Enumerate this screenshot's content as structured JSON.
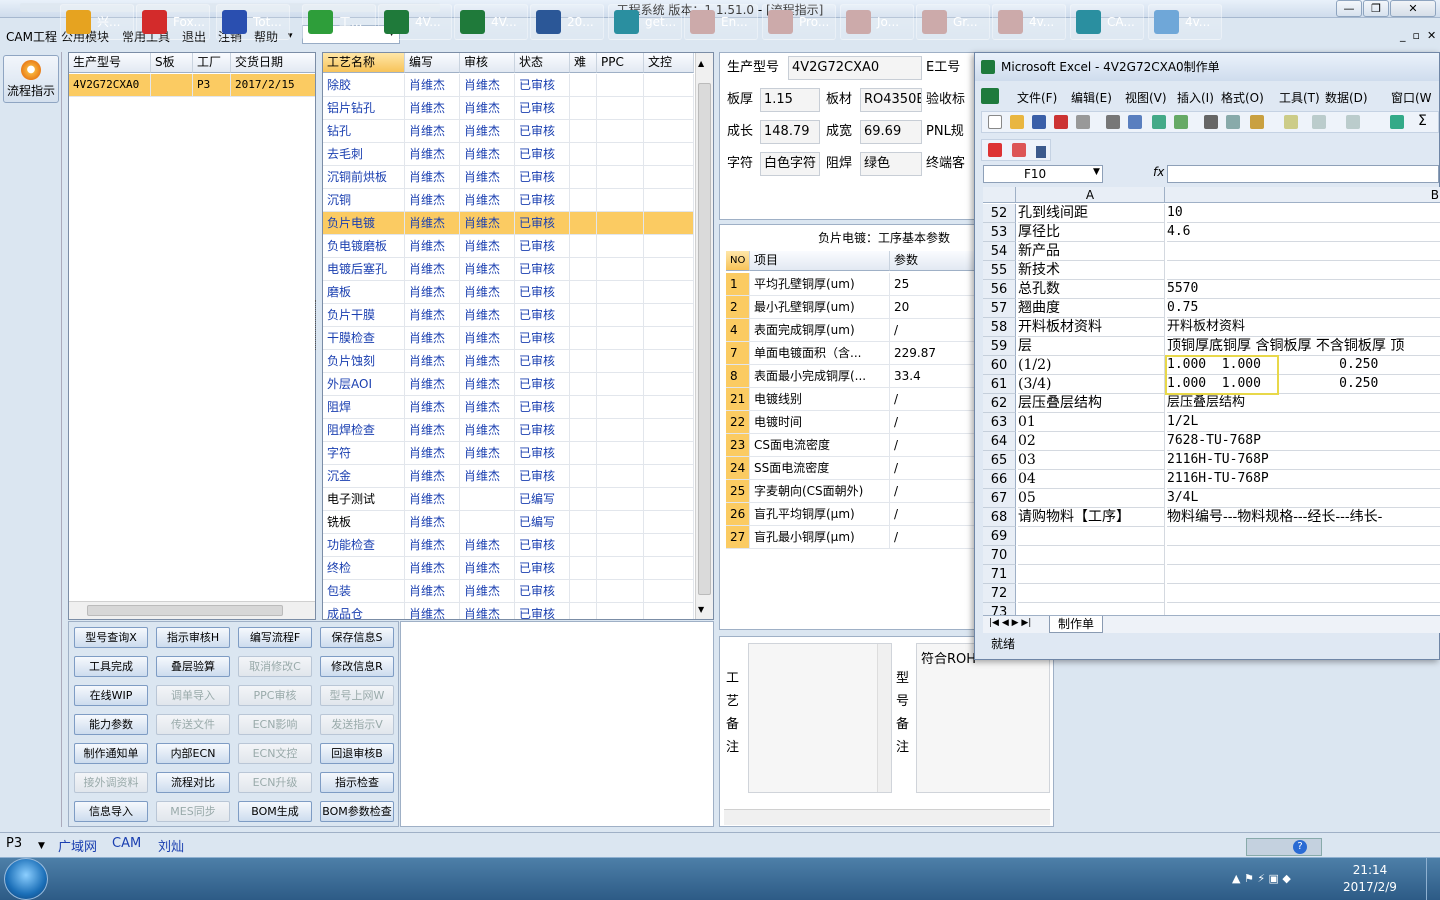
{
  "window": {
    "title": "工程系统 版本：1.1.51.0 - [流程指示]"
  },
  "menu": [
    "CAM工程",
    "公用模块",
    "常用工具",
    "退出",
    "注销",
    "帮助"
  ],
  "left": {
    "flow_button": "流程指示"
  },
  "order_grid": {
    "headers": [
      "生产型号",
      "S板",
      "工厂",
      "交货日期"
    ],
    "rows": [
      [
        "4V2G72CXA0",
        "",
        "P3",
        "2017/2/15"
      ]
    ]
  },
  "process_grid": {
    "headers": [
      "工艺名称",
      "编写",
      "审核",
      "状态",
      "难",
      "PPC",
      "文控"
    ],
    "rows": [
      [
        "除胶",
        "肖维杰",
        "肖维杰",
        "已审核"
      ],
      [
        "铝片钻孔",
        "肖维杰",
        "肖维杰",
        "已审核"
      ],
      [
        "钻孔",
        "肖维杰",
        "肖维杰",
        "已审核"
      ],
      [
        "去毛刺",
        "肖维杰",
        "肖维杰",
        "已审核"
      ],
      [
        "沉铜前烘板",
        "肖维杰",
        "肖维杰",
        "已审核"
      ],
      [
        "沉铜",
        "肖维杰",
        "肖维杰",
        "已审核"
      ],
      [
        "负片电镀",
        "肖维杰",
        "肖维杰",
        "已审核"
      ],
      [
        "负电镀磨板",
        "肖维杰",
        "肖维杰",
        "已审核"
      ],
      [
        "电镀后塞孔",
        "肖维杰",
        "肖维杰",
        "已审核"
      ],
      [
        "磨板",
        "肖维杰",
        "肖维杰",
        "已审核"
      ],
      [
        "负片干膜",
        "肖维杰",
        "肖维杰",
        "已审核"
      ],
      [
        "干膜检查",
        "肖维杰",
        "肖维杰",
        "已审核"
      ],
      [
        "负片蚀刻",
        "肖维杰",
        "肖维杰",
        "已审核"
      ],
      [
        "外层AOI",
        "肖维杰",
        "肖维杰",
        "已审核"
      ],
      [
        "阻焊",
        "肖维杰",
        "肖维杰",
        "已审核"
      ],
      [
        "阻焊检查",
        "肖维杰",
        "肖维杰",
        "已审核"
      ],
      [
        "字符",
        "肖维杰",
        "肖维杰",
        "已审核"
      ],
      [
        "沉金",
        "肖维杰",
        "肖维杰",
        "已审核"
      ],
      [
        "电子测试",
        "肖维杰",
        "",
        "已编写"
      ],
      [
        "铣板",
        "肖维杰",
        "",
        "已编写"
      ],
      [
        "功能检查",
        "肖维杰",
        "肖维杰",
        "已审核"
      ],
      [
        "终检",
        "肖维杰",
        "肖维杰",
        "已审核"
      ],
      [
        "包装",
        "肖维杰",
        "肖维杰",
        "已审核"
      ],
      [
        "成品仓",
        "肖维杰",
        "肖维杰",
        "已审核"
      ]
    ]
  },
  "buttons": [
    [
      "型号查询X",
      "指示审核H",
      "编写流程F",
      "保存信息S"
    ],
    [
      "工具完成",
      "叠层验算",
      "取消修改C",
      "修改信息R"
    ],
    [
      "在线WIP",
      "调单导入",
      "PPC审核",
      "型号上网W"
    ],
    [
      "能力参数",
      "传送文件",
      "ECN影响",
      "发送指示V"
    ],
    [
      "制作通知单",
      "内部ECN",
      "ECN文控",
      "回退审核B"
    ],
    [
      "接外调资料",
      "流程对比",
      "ECN升级",
      "指示检查"
    ],
    [
      "信息导入",
      "MES同步",
      "BOM生成",
      "BOM参数检查"
    ]
  ],
  "info": {
    "model_label": "生产型号",
    "model_value": "4V2G72CXA0",
    "e_label": "E工号",
    "thick_label": "板厚",
    "thick_value": "1.15",
    "mat_label": "板材",
    "mat_value": "RO4350B",
    "accept_label": "验收标",
    "len_label": "成长",
    "len_value": "148.79",
    "wid_label": "成宽",
    "wid_value": "69.69",
    "pnl_label": "PNL规",
    "char_label": "字符",
    "char_value": "白色字符",
    "mask_label": "阻焊",
    "mask_value": "绿色",
    "end_label": "终端客"
  },
  "params": {
    "title": "负片电镀：工序基本参数",
    "headers": [
      "NO",
      "项目",
      "参数"
    ],
    "rows": [
      [
        "1",
        "平均孔壁铜厚(um)",
        "25"
      ],
      [
        "2",
        "最小孔壁铜厚(um)",
        "20"
      ],
      [
        "4",
        "表面完成铜厚(um)",
        "/"
      ],
      [
        "7",
        "单面电镀面积（含...",
        "229.87"
      ],
      [
        "8",
        "表面最小完成铜厚(...",
        "33.4"
      ],
      [
        "21",
        "电镀线别",
        "/"
      ],
      [
        "22",
        "电镀时间",
        "/"
      ],
      [
        "23",
        "CS面电流密度",
        "/"
      ],
      [
        "24",
        "SS面电流密度",
        "/"
      ],
      [
        "25",
        "字麦朝向(CS面朝外)",
        "/"
      ],
      [
        "26",
        "盲孔平均铜厚(μm)",
        "/"
      ],
      [
        "27",
        "盲孔最小铜厚(μm)",
        "/"
      ]
    ]
  },
  "notes": {
    "process_label": "工艺备注",
    "model_label": "型号备注",
    "model_text": "符合ROH"
  },
  "excel": {
    "title": "Microsoft Excel - 4V2G72CXA0制作单",
    "menu": [
      "文件(F)",
      "编辑(E)",
      "视图(V)",
      "插入(I)",
      "格式(O)",
      "工具(T)",
      "数据(D)",
      "窗口(W"
    ],
    "namebox": "F10",
    "fx": "fx",
    "col_a": "A",
    "col_b": "B",
    "rows": [
      [
        "52",
        "孔到线间距",
        "10"
      ],
      [
        "53",
        "厚径比",
        "4.6"
      ],
      [
        "54",
        "新产品",
        ""
      ],
      [
        "55",
        "新技术",
        ""
      ],
      [
        "56",
        "总孔数",
        "5570"
      ],
      [
        "57",
        "翘曲度",
        "0.75"
      ],
      [
        "58",
        "开料板材资料",
        "开料板材资料"
      ],
      [
        "59",
        "层",
        "顶铜厚底铜厚 含铜板厚 不含铜板厚 顶"
      ],
      [
        "60",
        "(1/2)",
        "1.000  1.000          0.250"
      ],
      [
        "61",
        "(3/4)",
        "1.000  1.000          0.250"
      ],
      [
        "62",
        "层压叠层结构",
        "层压叠层结构"
      ],
      [
        "63",
        "01",
        "1/2L"
      ],
      [
        "64",
        "02",
        "7628-TU-768P"
      ],
      [
        "65",
        "03",
        "2116H-TU-768P"
      ],
      [
        "66",
        "04",
        "2116H-TU-768P"
      ],
      [
        "67",
        "05",
        "3/4L"
      ],
      [
        "68",
        "请购物料【工序】",
        "物料编号---物料规格---经长---纬长-"
      ],
      [
        "69",
        "",
        ""
      ],
      [
        "70",
        "",
        ""
      ],
      [
        "71",
        "",
        ""
      ],
      [
        "72",
        "",
        ""
      ],
      [
        "73",
        "",
        ""
      ]
    ],
    "sheet_tab": "制作单",
    "status": "就绪"
  },
  "bottom": {
    "factory": "P3",
    "links": [
      "广域网",
      "CAM",
      "刘灿"
    ]
  },
  "taskbar": {
    "items": [
      "兴...",
      "Fox...",
      "Tot...",
      "工...",
      "4V...",
      "4V...",
      "20...",
      "get...",
      "En...",
      "Pro...",
      "Jo...",
      "Gr...",
      "4v...",
      "CA...",
      "4v..."
    ],
    "time": "21:14",
    "date": "2017/2/9"
  },
  "colors": {
    "selected_row": "#fbcb62",
    "highlight_box": "#e8d84a",
    "link_blue": "#1a3fb0"
  }
}
